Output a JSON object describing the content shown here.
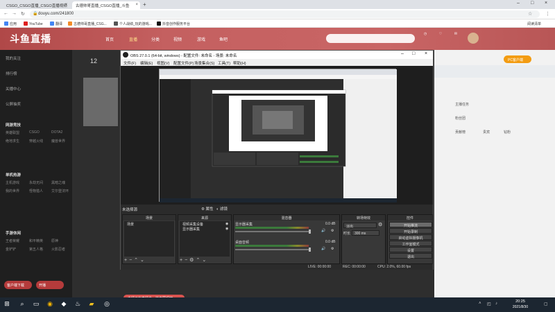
{
  "browser": {
    "tabs": [
      {
        "title": "CSGO_CSGO直播_CSGO直播视频"
      },
      {
        "title": "古德帅哥直播_CSGO直播_斗鱼"
      }
    ],
    "url": "douyu.com/241800",
    "bookmarks": [
      "应用",
      "YouTube",
      "翻译",
      "古德帅哥直播_CSG...",
      "个人战绩_玩的游戏...",
      "抖音创作服务平台"
    ],
    "reading_list": "阅读清单"
  },
  "douyu": {
    "logo": "斗鱼直播",
    "nav": [
      "首页",
      "直播",
      "分类",
      "视频",
      "游戏",
      "鱼吧"
    ],
    "sidebar_top": [
      "我的关注",
      "排行榜",
      "关播中心",
      "公屏抽奖"
    ],
    "sidebar_sections": [
      {
        "title": "网游竞技",
        "games": [
          "英雄联盟",
          "CSGO",
          "DOTA2",
          "绝地求生",
          "穿越火线",
          "魔兽世界"
        ]
      },
      {
        "title": "单机热游",
        "games": [
          "主机游戏",
          "永劫无间",
          "黑暗之魂",
          "我的世界",
          "怪物猎人",
          "艾尔登法环"
        ]
      },
      {
        "title": "手游休闲",
        "games": [
          "王者荣耀",
          "和平精英",
          "原神",
          "金铲铲",
          "第五人格",
          "火影忍者"
        ]
      }
    ],
    "sidebar_buttons": [
      "客户端下载",
      "开播"
    ],
    "stat_number": "12",
    "pc_button": "PC客户端",
    "right_labels": [
      "主播任务",
      "粉丝团",
      "贡献榜",
      "贵宾",
      "钻粉"
    ],
    "red_bar": "主播正在直播中，快来围观吧"
  },
  "obs": {
    "title": "OBS 27.0.1 (64-bit, windows) - 配置文件: 未命名 - 场景: 未命名",
    "menu": [
      "文件(F)",
      "编辑(E)",
      "视图(V)",
      "配置文件(P)",
      "场景集合(S)",
      "工具(T)",
      "帮助(H)"
    ],
    "no_source": "未选择源",
    "toolbar": [
      "属性",
      "滤镜"
    ],
    "docks": {
      "scenes": {
        "title": "场景",
        "items": [
          "场景"
        ]
      },
      "sources": {
        "title": "来源",
        "items": [
          "视频采集设备",
          "显示器采集"
        ]
      },
      "mixer": {
        "title": "混音器",
        "channels": [
          {
            "name": "显示器采集",
            "db": "0.0 dB"
          },
          {
            "name": "桌面音频",
            "db": "0.0 dB"
          }
        ]
      },
      "transitions": {
        "title": "转场特效",
        "type": "淡出",
        "duration_label": "时长",
        "duration": "300 ms"
      },
      "controls": {
        "title": "控件",
        "buttons": [
          "开始推流",
          "开始录制",
          "启动虚拟摄像机",
          "工作室模式",
          "设置",
          "退出"
        ]
      }
    },
    "status": {
      "live": "LIVE: 00:00:00",
      "rec": "REC: 00:00:00",
      "cpu": "CPU: 2.0%, 60.00 fps"
    }
  },
  "taskbar": {
    "time": "20:25",
    "date": "2021/8/30"
  },
  "colors": {
    "brand": "#c45a5a",
    "obs_bg": "#2b2b2b",
    "taskbar": "#1c2631"
  }
}
